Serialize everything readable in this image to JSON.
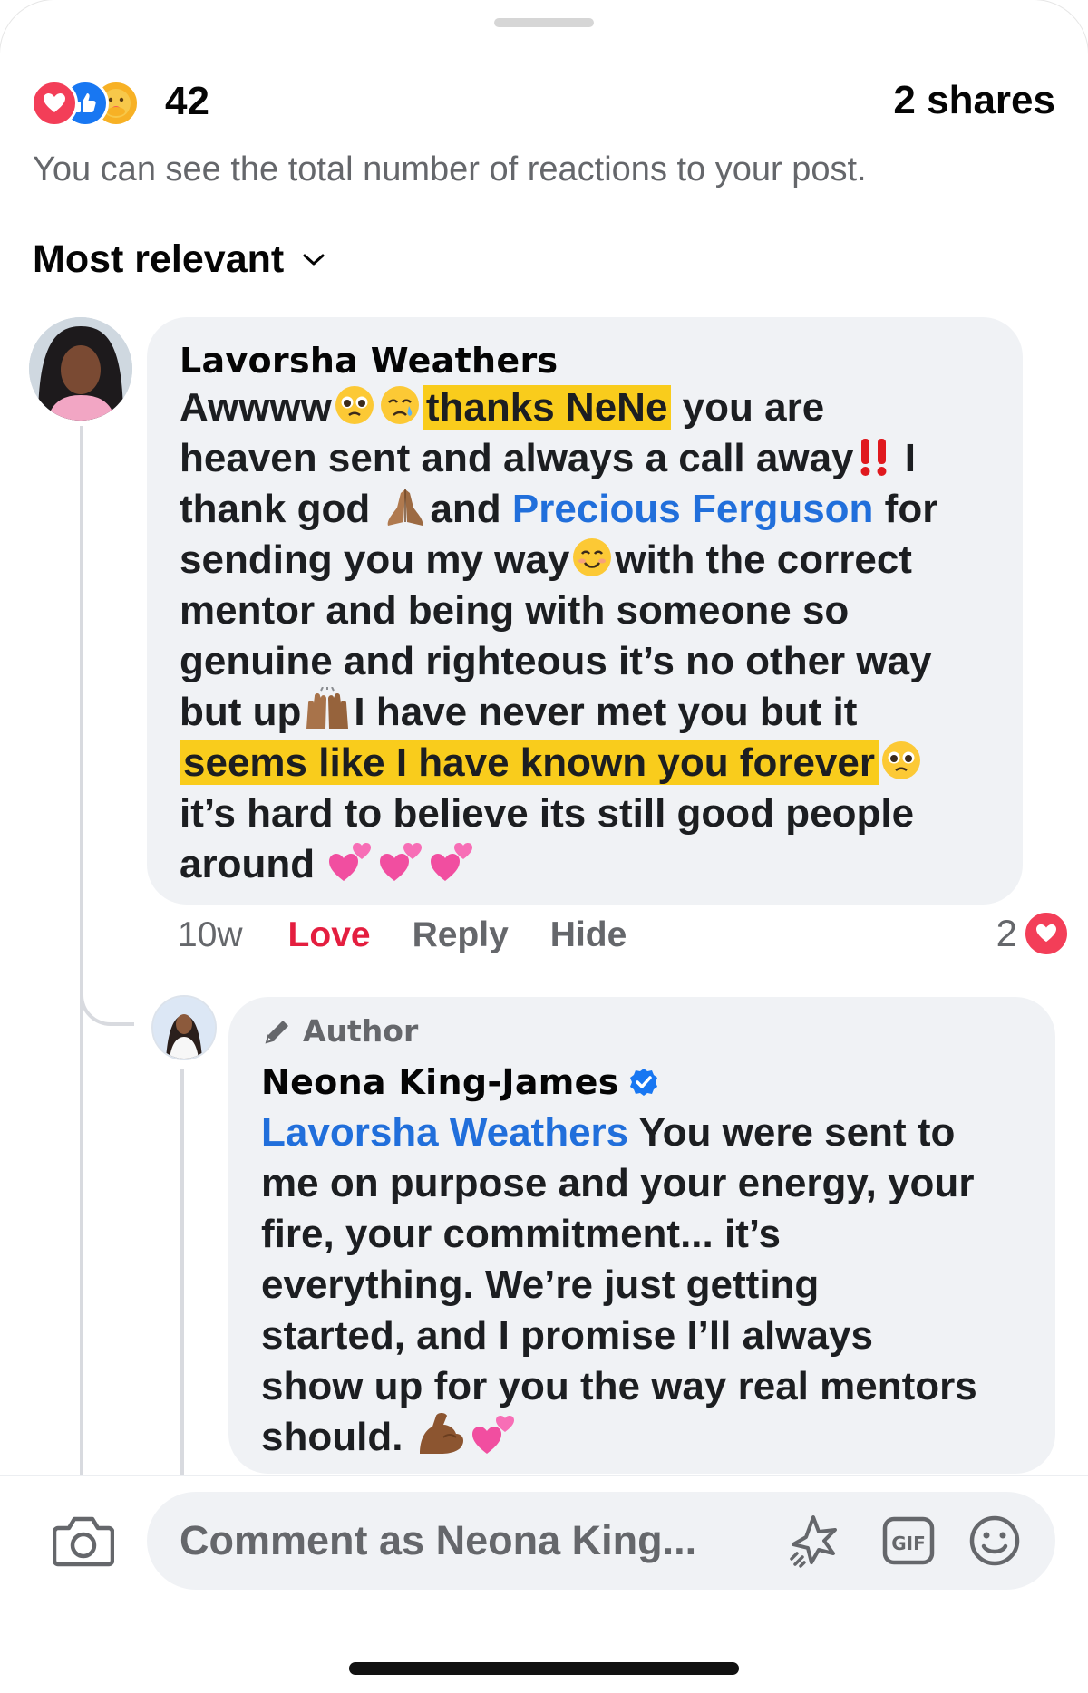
{
  "header": {
    "reaction_count": "42",
    "reaction_icons": [
      "love-icon",
      "like-icon",
      "care-icon"
    ],
    "shares": "2 shares",
    "info": "You can see the total number of reactions to your post.",
    "sort_label": "Most relevant"
  },
  "comments": [
    {
      "author": "Lavorsha Weathers",
      "lines": [
        [
          "Awwww",
          "",
          "thanks NeNe",
          " you are"
        ],
        [
          "heaven sent and always a call away",
          " I"
        ],
        [
          "thank god ",
          "and ",
          "Precious Ferguson",
          " for"
        ],
        [
          "sending you my way",
          "with the correct"
        ],
        [
          "mentor and being with someone so"
        ],
        [
          "genuine and righteous it’s no other way"
        ],
        [
          "but up",
          "I have never met you but it"
        ],
        [
          "seems like I have known you forever"
        ],
        [
          "it’s hard to believe its still good people"
        ],
        [
          "around "
        ]
      ],
      "time": "10w",
      "love_label": "Love",
      "reply_label": "Reply",
      "hide_label": "Hide",
      "reaction_count": "2"
    },
    {
      "author_tag": "Author",
      "author": "Neona King-James",
      "mention": "Lavorsha Weathers",
      "lines": [
        " You were sent to",
        "me on purpose and your energy, your",
        "fire, your commitment... it’s",
        "everything. We’re just getting",
        "started, and I promise I’ll always",
        "show up for you the way real mentors",
        "should. "
      ]
    }
  ],
  "composer": {
    "placeholder": "Comment as Neona King...",
    "icons": [
      "camera-icon",
      "sticker-icon",
      "gif-icon",
      "emoji-icon"
    ],
    "gif_label": "GIF"
  },
  "colors": {
    "accent_blue": "#216fdb",
    "love_red": "#e41e3f",
    "highlight": "#f9cc1c",
    "bubble_bg": "#f0f2f5"
  }
}
